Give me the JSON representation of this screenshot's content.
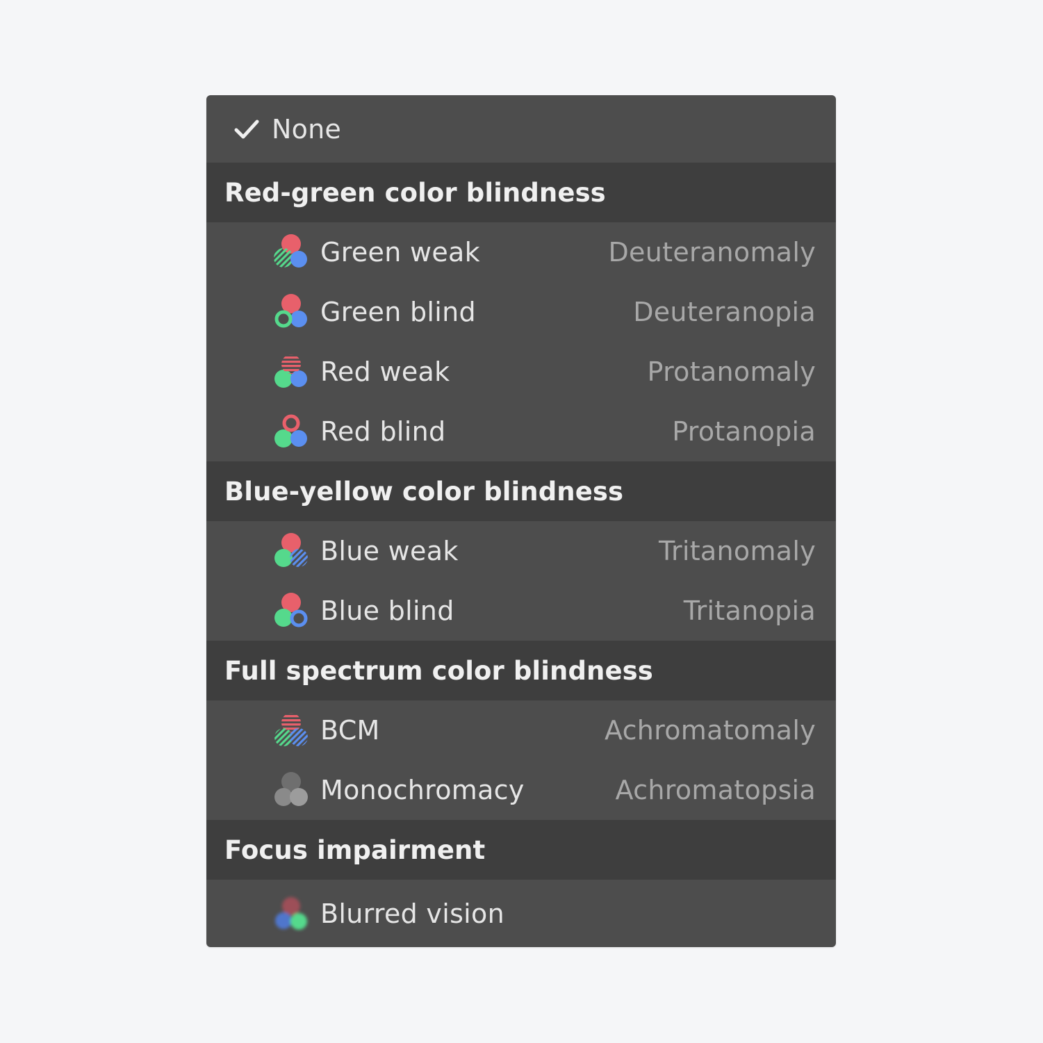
{
  "menu": {
    "none_option": {
      "label": "None",
      "checked": true,
      "icon": "checkmark-icon"
    },
    "sections": [
      {
        "title": "Red-green color blindness",
        "items": [
          {
            "label": "Green weak",
            "term": "Deuteranomaly",
            "icon": "green-weak-icon"
          },
          {
            "label": "Green blind",
            "term": "Deuteranopia",
            "icon": "green-blind-icon"
          },
          {
            "label": "Red weak",
            "term": "Protanomaly",
            "icon": "red-weak-icon"
          },
          {
            "label": "Red blind",
            "term": "Protanopia",
            "icon": "red-blind-icon"
          }
        ]
      },
      {
        "title": "Blue-yellow color blindness",
        "items": [
          {
            "label": "Blue weak",
            "term": "Tritanomaly",
            "icon": "blue-weak-icon"
          },
          {
            "label": "Blue blind",
            "term": "Tritanopia",
            "icon": "blue-blind-icon"
          }
        ]
      },
      {
        "title": "Full spectrum color blindness",
        "items": [
          {
            "label": "BCM",
            "term": "Achromatomaly",
            "icon": "bcm-icon"
          },
          {
            "label": "Monochromacy",
            "term": "Achromatopsia",
            "icon": "monochromacy-icon"
          }
        ]
      },
      {
        "title": "Focus impairment",
        "items": [
          {
            "label": "Blurred vision",
            "term": "",
            "icon": "blurred-vision-icon"
          }
        ]
      }
    ]
  },
  "colors": {
    "red": "#e8606b",
    "green": "#55d98c",
    "blue": "#5b8ff0",
    "gray": "#8a8a8a",
    "menu_bg": "#4d4d4d",
    "section_bg": "#3e3e3e",
    "page_bg": "#f5f6f8"
  }
}
